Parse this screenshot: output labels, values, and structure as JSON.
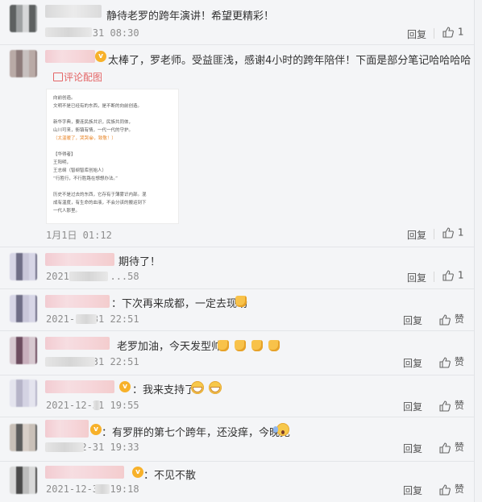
{
  "comments": [
    {
      "text": "静待老罗的跨年演讲！希望更精彩！",
      "time": "2021-12-31 08:30",
      "reply": "回复",
      "likes": "1"
    },
    {
      "text": "太棒了，罗老师。受益匪浅，感谢4小时的跨年陪伴！下面是部分笔记哈哈哈哈",
      "pic_label": "评论配图",
      "note_lines": [
        "向前创造。",
        "文明不是已经有的东西，是不断的向前创造。",
        "新华字典，要连民族共识，民族共同体，",
        "山川可来，衙镇有情，一代一代的守护。",
        "（太温暖了，哭哭😭，致敬！）",
        "【华得者】",
        "王阳明，",
        "王志纲（智纲智库创始人）",
        "“行胜行，不行胜路在想想办法。”",
        "历史不是过去的东西，它存有于薄雾识内部。混",
        "成有温度，有生命的血液，不会分该的搬运到下",
        "一代人那里。"
      ],
      "time": "1月1日 01:12",
      "reply": "回复",
      "likes": "1"
    },
    {
      "text": "期待了！",
      "time": "2021-12-31 ...58",
      "reply": "回复",
      "likes": "1"
    },
    {
      "text": "：下次再来成都，一定去现场",
      "time": "2021-12-31 22:51",
      "reply": "回复",
      "likes": "赞"
    },
    {
      "text": "老罗加油，今天发型帅",
      "time": "2021-12-31 22:51",
      "reply": "回复",
      "likes": "赞"
    },
    {
      "text": "：我来支持了",
      "time": "2021-12-31 19:55",
      "reply": "回复",
      "likes": "赞"
    },
    {
      "text": "：有罗胖的第七个跨年，还没痒，今晚见",
      "time": "2021-12-31 19:33",
      "reply": "回复",
      "likes": "赞"
    },
    {
      "text": "：不见不散",
      "time": "2021-12-31 19:18",
      "reply": "回复",
      "likes": "赞"
    }
  ],
  "colors": {
    "accent_red": "#e46566",
    "badge_gold": "#f7b12a",
    "separator": "#e3e5e8"
  }
}
